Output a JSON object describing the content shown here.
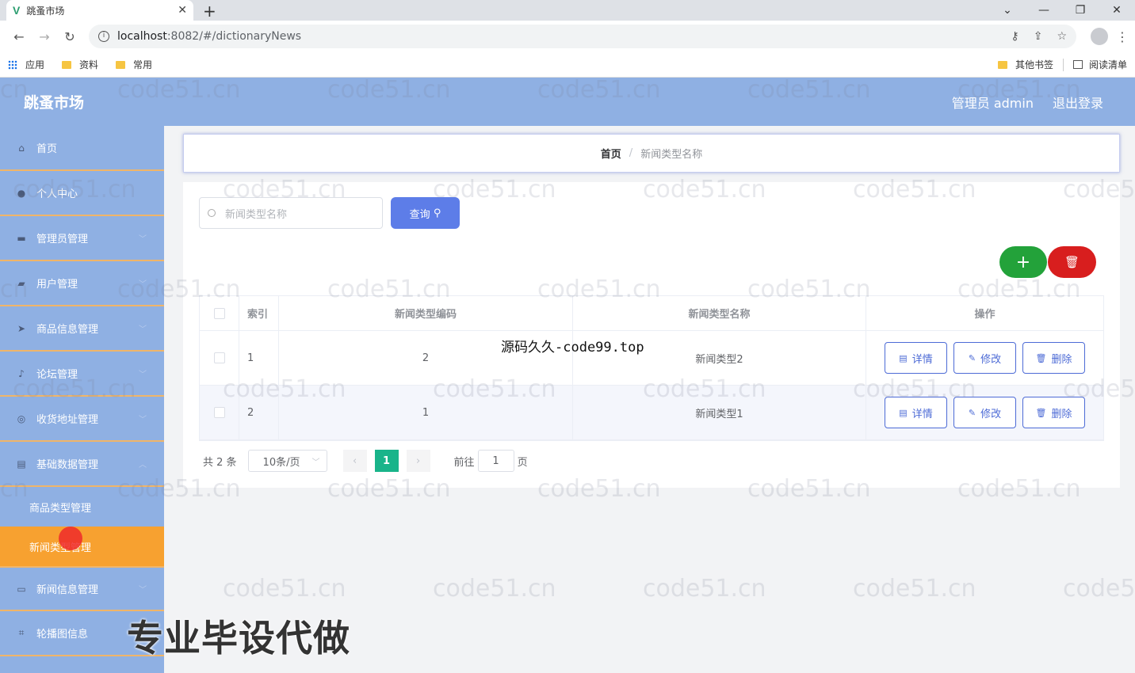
{
  "browser": {
    "tab_title": "跳蚤市场",
    "url_host": "localhost",
    "url_rest": ":8082/#/dictionaryNews",
    "bookmarks": [
      "应用",
      "资料",
      "常用"
    ],
    "bookmarks_right": [
      "其他书签",
      "阅读清单"
    ]
  },
  "header": {
    "app_title": "跳蚤市场",
    "user_label": "管理员 admin",
    "logout_label": "退出登录"
  },
  "sidebar": {
    "items": [
      {
        "label": "首页",
        "icon": "home-icon"
      },
      {
        "label": "个人中心",
        "icon": "user-icon"
      },
      {
        "label": "管理员管理",
        "icon": "admin-icon"
      },
      {
        "label": "用户管理",
        "icon": "users-icon"
      },
      {
        "label": "商品信息管理",
        "icon": "send-icon"
      },
      {
        "label": "论坛管理",
        "icon": "mic-icon"
      },
      {
        "label": "收货地址管理",
        "icon": "compass-icon"
      },
      {
        "label": "基础数据管理",
        "icon": "data-icon"
      }
    ],
    "subitems": [
      {
        "label": "商品类型管理"
      },
      {
        "label": "新闻类型管理"
      }
    ],
    "bottom_items": [
      {
        "label": "新闻信息管理",
        "icon": "news-icon"
      },
      {
        "label": "轮播图信息",
        "icon": "crop-icon"
      }
    ]
  },
  "breadcrumb": {
    "home": "首页",
    "separator": "/",
    "current": "新闻类型名称"
  },
  "search": {
    "placeholder": "新闻类型名称",
    "query_label": "查询"
  },
  "actions": {
    "add": "+",
    "delete_icon": "trash-icon"
  },
  "table": {
    "headers": [
      "索引",
      "新闻类型编码",
      "新闻类型名称",
      "操作"
    ],
    "rows": [
      {
        "index": "1",
        "code": "2",
        "name": "新闻类型2"
      },
      {
        "index": "2",
        "code": "1",
        "name": "新闻类型1"
      }
    ],
    "row_actions": {
      "detail": "详情",
      "edit": "修改",
      "delete": "删除"
    }
  },
  "pagination": {
    "total": "共 2 条",
    "page_size": "10条/页",
    "current_page": "1",
    "goto_label": "前往",
    "goto_value": "1",
    "page_suffix": "页"
  },
  "overlays": {
    "watermark": "code51.cn",
    "center_text": "源码久久-code99.top",
    "banner_text": "专业毕设代做"
  },
  "colors": {
    "sidebar_bg": "#8fb0e3",
    "active_item": "#f7a130",
    "query_button": "#5d7de8",
    "add_button": "#23a23a",
    "delete_button": "#d81e1e",
    "current_page": "#19b48a"
  }
}
